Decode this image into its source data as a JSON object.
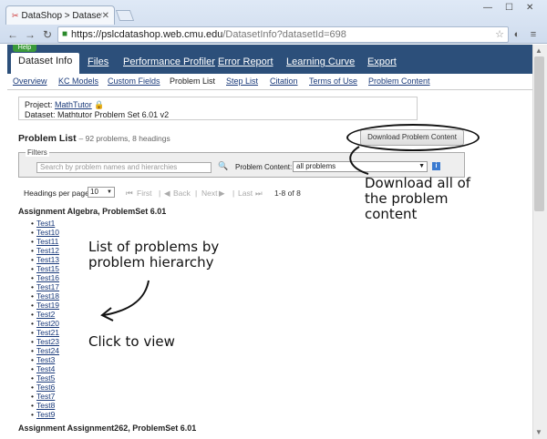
{
  "browser": {
    "tab_title": "DataShop > Dataset Info",
    "url_host": "https://pslcdatashop.web.cmu.edu",
    "url_path": "/DatasetInfo?datasetId=698"
  },
  "site": {
    "help": "Help",
    "main_tabs": [
      "Dataset Info",
      "Files",
      "Performance Profiler",
      "Error Report",
      "Learning Curve",
      "Export"
    ],
    "sub_tabs": [
      "Overview",
      "KC Models",
      "Custom Fields",
      "Problem List",
      "Step List",
      "Citation",
      "Terms of Use",
      "Problem Content"
    ]
  },
  "project": {
    "project_label": "Project:",
    "project_name": "MathTutor",
    "dataset_label": "Dataset:",
    "dataset_name": "Mathtutor Problem Set 6.01 v2"
  },
  "problem_list": {
    "title": "Problem List",
    "subtitle": "– 92 problems, 8 headings",
    "download_button": "Download Problem Content",
    "filters_legend": "Filters",
    "search_placeholder": "Search by problem names and hierarchies",
    "content_label": "Problem Content:",
    "content_value": "all problems",
    "headings_per_page_label": "Headings per page:",
    "headings_per_page_value": "10",
    "first": "First",
    "back": "Back",
    "next": "Next",
    "last": "Last",
    "range": "1-8 of 8",
    "groups": [
      {
        "heading": "Assignment Algebra, ProblemSet 6.01",
        "problems": [
          "Test1",
          "Test10",
          "Test11",
          "Test12",
          "Test13",
          "Test15",
          "Test16",
          "Test17",
          "Test18",
          "Test19",
          "Test2",
          "Test20",
          "Test21",
          "Test23",
          "Test24",
          "Test3",
          "Test4",
          "Test5",
          "Test6",
          "Test7",
          "Test8",
          "Test9"
        ]
      },
      {
        "heading": "Assignment Assignment262, ProblemSet 6.01",
        "problems": []
      }
    ]
  },
  "annotations": {
    "download_note": [
      "Download all of",
      "the problem",
      "content"
    ],
    "list_note": [
      "List of problems by",
      "problem hierarchy"
    ],
    "click_note": "Click to view"
  }
}
